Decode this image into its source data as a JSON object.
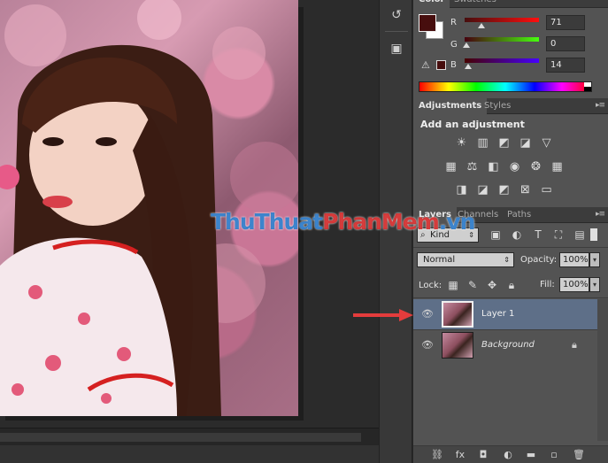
{
  "tools": {
    "history_icon": "history-icon",
    "properties_icon": "cube-icon"
  },
  "color_panel": {
    "tabs": [
      "Color",
      "Swatches"
    ],
    "channels": [
      {
        "label": "R",
        "value": "71"
      },
      {
        "label": "G",
        "value": "0"
      },
      {
        "label": "B",
        "value": "14"
      }
    ],
    "foreground": "#470e0e"
  },
  "adjustments_panel": {
    "tabs": [
      "Adjustments",
      "Styles"
    ],
    "title": "Add an adjustment"
  },
  "layers_panel": {
    "tabs": [
      "Layers",
      "Channels",
      "Paths"
    ],
    "kind_label": "Kind",
    "blend_mode": "Normal",
    "opacity_label": "Opacity:",
    "opacity_value": "100%",
    "lock_label": "Lock:",
    "fill_label": "Fill:",
    "fill_value": "100%",
    "layers": [
      {
        "name": "Layer 1",
        "selected": true
      },
      {
        "name": "Background",
        "selected": false,
        "locked": true
      }
    ]
  },
  "watermark": {
    "part1": "ThuThuat",
    "part2": "PhanMem",
    "part3": ".vn"
  }
}
